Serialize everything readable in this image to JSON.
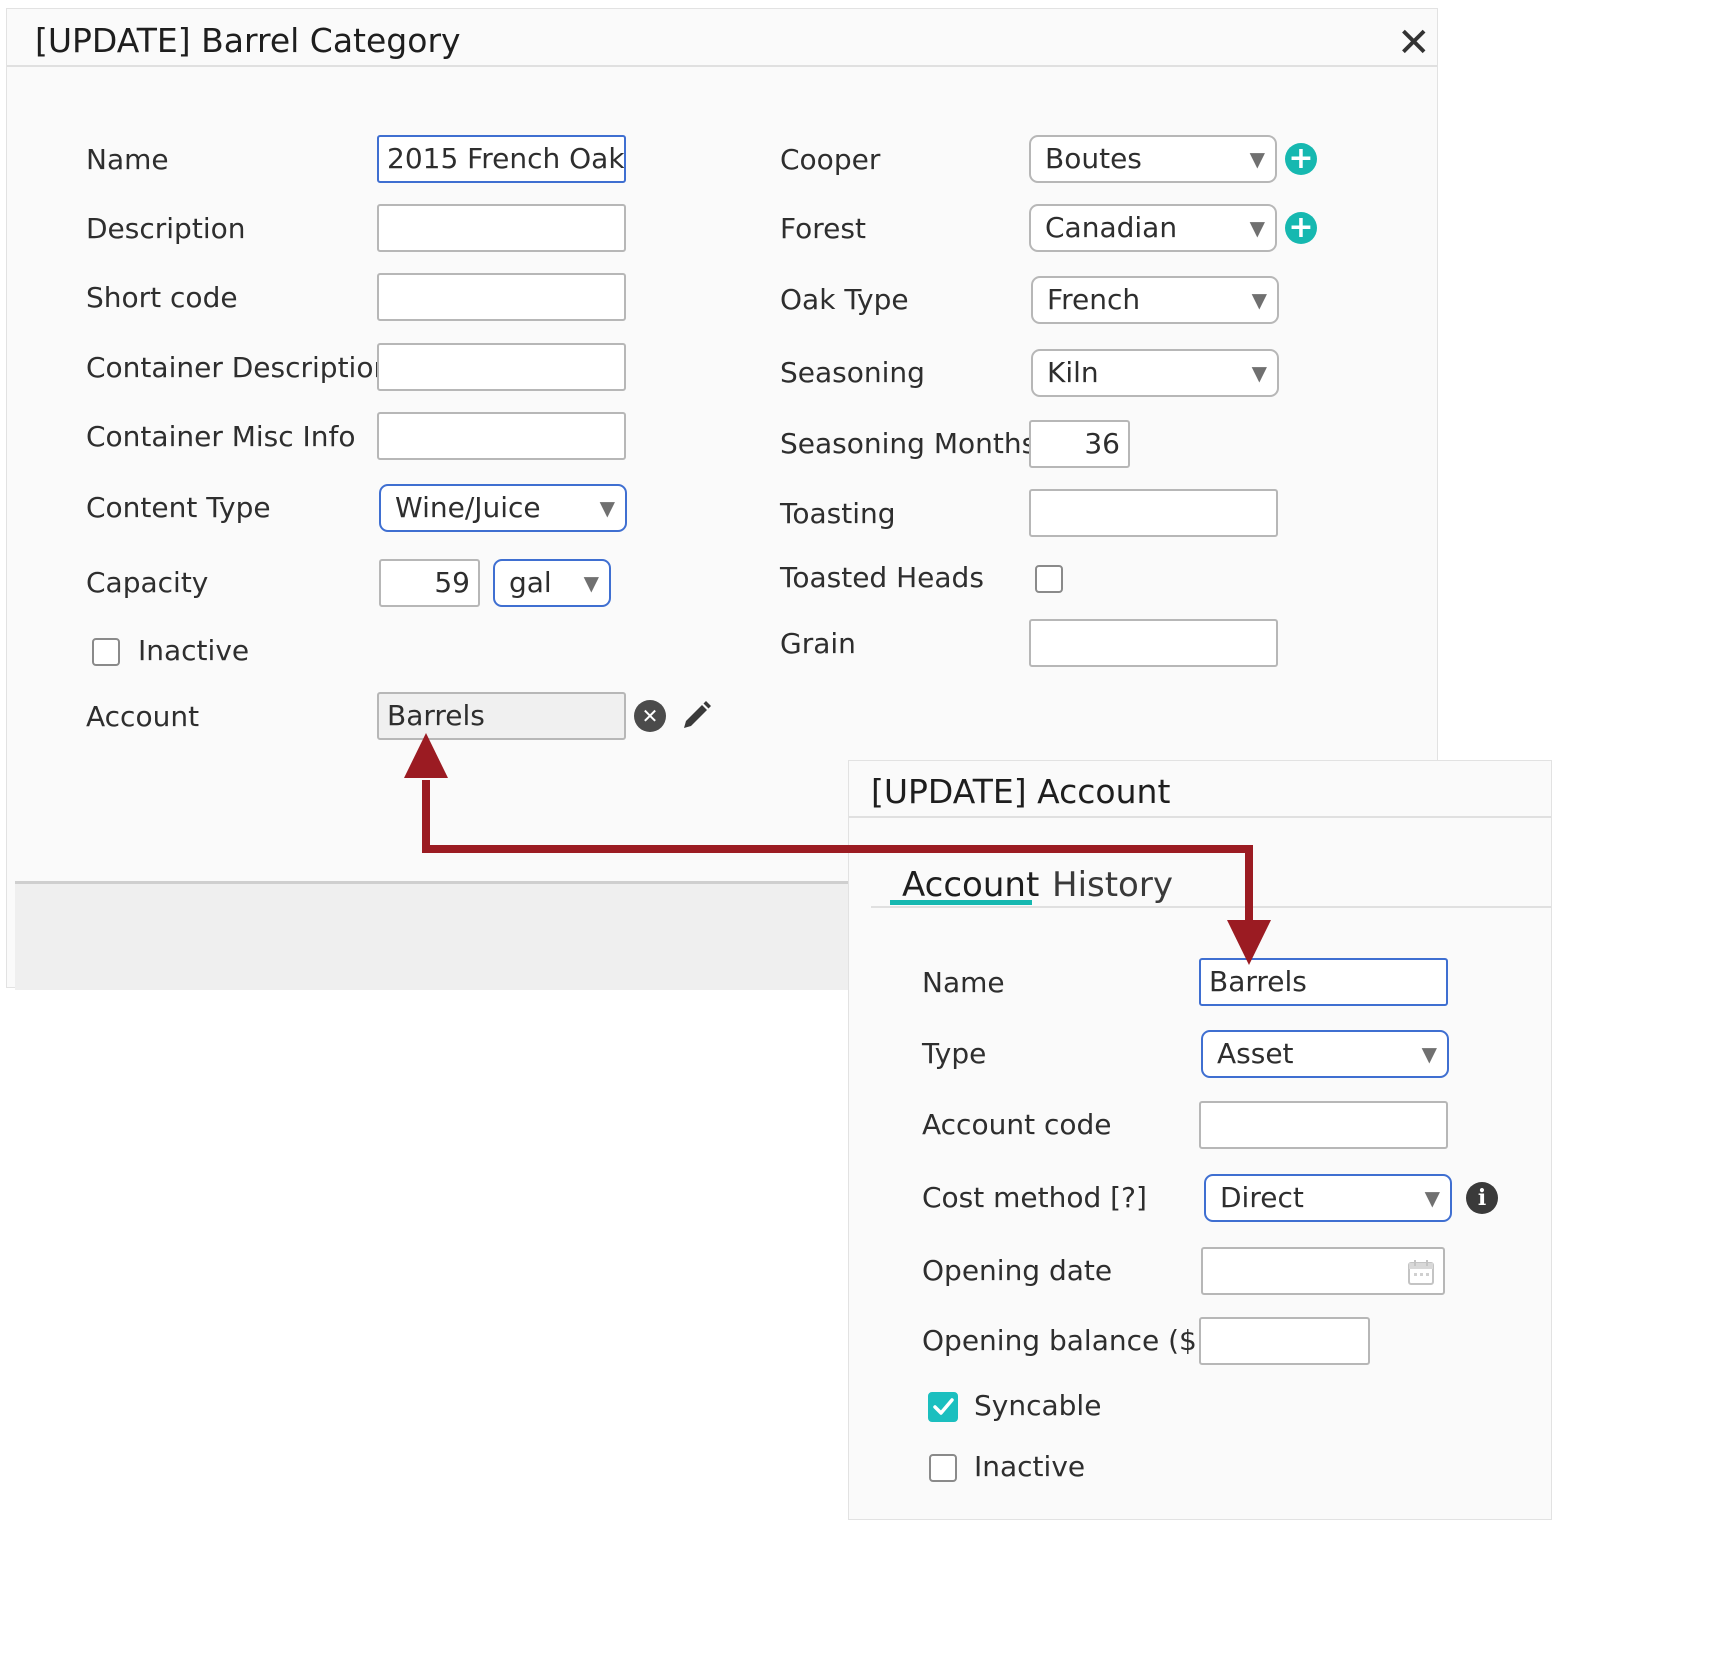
{
  "barrel_dialog": {
    "title": "[UPDATE] Barrel Category",
    "close_symbol": "✕",
    "labels": {
      "name": "Name",
      "description": "Description",
      "short_code": "Short code",
      "container_description": "Container Description",
      "container_misc_info": "Container Misc Info",
      "content_type": "Content Type",
      "capacity": "Capacity",
      "inactive": "Inactive",
      "account": "Account",
      "cooper": "Cooper",
      "forest": "Forest",
      "oak_type": "Oak Type",
      "seasoning": "Seasoning",
      "seasoning_months": "Seasoning Months",
      "toasting": "Toasting",
      "toasted_heads": "Toasted Heads",
      "grain": "Grain"
    },
    "values": {
      "name": "2015 French Oak",
      "description": "",
      "short_code": "",
      "container_description": "",
      "container_misc_info": "",
      "content_type": "Wine/Juice",
      "capacity": "59",
      "capacity_unit": "gal",
      "inactive": false,
      "account": "Barrels",
      "cooper": "Boutes",
      "forest": "Canadian",
      "oak_type": "French",
      "seasoning": "Kiln",
      "seasoning_months": "36",
      "toasting": "",
      "toasted_heads": false,
      "grain": ""
    }
  },
  "account_dialog": {
    "title": "[UPDATE] Account",
    "tabs": [
      {
        "label": "Account",
        "active": true
      },
      {
        "label": "History",
        "active": false
      }
    ],
    "labels": {
      "name": "Name",
      "type": "Type",
      "account_code": "Account code",
      "cost_method": "Cost method [?]",
      "opening_date": "Opening date",
      "opening_balance": "Opening balance ($)",
      "syncable": "Syncable",
      "inactive": "Inactive"
    },
    "values": {
      "name": "Barrels",
      "type": "Asset",
      "account_code": "",
      "cost_method": "Direct",
      "opening_date": "",
      "opening_balance": "",
      "syncable": true,
      "inactive": false
    }
  },
  "colors": {
    "accent_teal": "#16b8b0",
    "focus_blue": "#3f6fd1",
    "arrow_red": "#9b1b22"
  }
}
